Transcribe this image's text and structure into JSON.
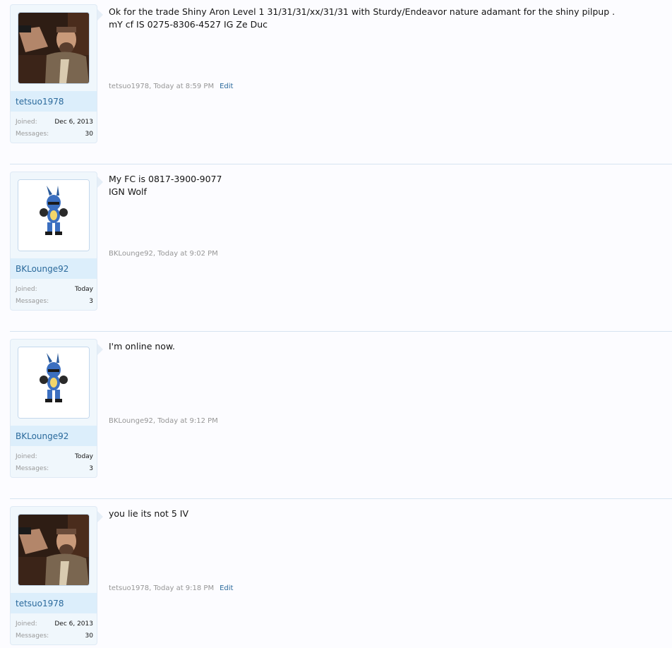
{
  "posts": [
    {
      "username": "tetsuo1978",
      "avatar": "man-with-gun-photo",
      "joined_label": "Joined:",
      "joined_value": "Dec 6, 2013",
      "messages_label": "Messages:",
      "messages_value": "30",
      "message": "Ok for the trade Shiny Aron Level 1 31/31/31/xx/31/31 with Sturdy/Endeavor nature adamant for the shiny pilpup .\nmY cf IS 0275-8306-4527 IG Ze Duc",
      "meta": "tetsuo1978, Today at 8:59 PM",
      "edit_label": "Edit"
    },
    {
      "username": "BKLounge92",
      "avatar": "lucario-sprite",
      "joined_label": "Joined:",
      "joined_value": "Today",
      "messages_label": "Messages:",
      "messages_value": "3",
      "message": "My FC is 0817-3900-9077\nIGN Wolf",
      "meta": "BKLounge92, Today at 9:02 PM",
      "edit_label": ""
    },
    {
      "username": "BKLounge92",
      "avatar": "lucario-sprite",
      "joined_label": "Joined:",
      "joined_value": "Today",
      "messages_label": "Messages:",
      "messages_value": "3",
      "message": "I'm online now.",
      "meta": "BKLounge92, Today at 9:12 PM",
      "edit_label": ""
    },
    {
      "username": "tetsuo1978",
      "avatar": "man-with-gun-photo",
      "joined_label": "Joined:",
      "joined_value": "Dec 6, 2013",
      "messages_label": "Messages:",
      "messages_value": "30",
      "message": "you lie its not 5 IV",
      "meta": "tetsuo1978, Today at 9:18 PM",
      "edit_label": "Edit"
    }
  ],
  "colors": {
    "link": "#2b6a9c",
    "username_bar": "#dceefb",
    "userblock_bg": "#f0f7fc",
    "separator": "#d6e4f1"
  }
}
